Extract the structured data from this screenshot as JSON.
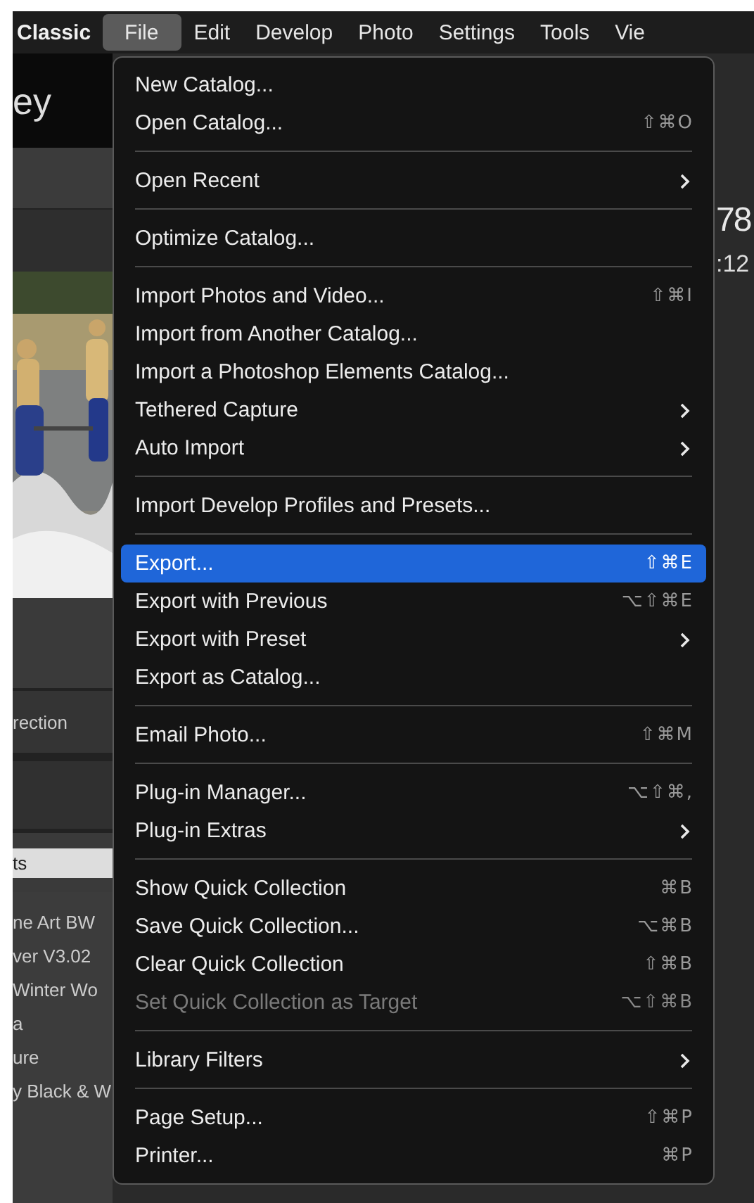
{
  "menubar": {
    "app_title": "Classic",
    "menus": [
      {
        "label": "File",
        "selected": true
      },
      {
        "label": "Edit",
        "selected": false
      },
      {
        "label": "Develop",
        "selected": false
      },
      {
        "label": "Photo",
        "selected": false
      },
      {
        "label": "Settings",
        "selected": false
      },
      {
        "label": "Tools",
        "selected": false
      },
      {
        "label": "Vie",
        "selected": false
      }
    ]
  },
  "left_panel": {
    "title": "ey",
    "section_label": "rection",
    "selected_item": "ts",
    "items": [
      "ne Art BW",
      "ver V3.02",
      "Winter Wo",
      "a",
      "ure",
      "y Black & W"
    ],
    "photo": {
      "kind": "picture"
    }
  },
  "main": {
    "count": "78",
    "time": ":12"
  },
  "file_menu": [
    {
      "kind": "item",
      "label": "New Catalog...",
      "selected": false,
      "disabled": false
    },
    {
      "kind": "item",
      "label": "Open Catalog...",
      "shortcut": "⇧⌘O",
      "selected": false,
      "disabled": false
    },
    {
      "kind": "separator"
    },
    {
      "kind": "submenu",
      "label": "Open Recent",
      "selected": false,
      "disabled": false
    },
    {
      "kind": "separator"
    },
    {
      "kind": "item",
      "label": "Optimize Catalog...",
      "selected": false,
      "disabled": false
    },
    {
      "kind": "separator"
    },
    {
      "kind": "item",
      "label": "Import Photos and Video...",
      "shortcut": "⇧⌘I",
      "selected": false,
      "disabled": false
    },
    {
      "kind": "item",
      "label": "Import from Another Catalog...",
      "selected": false,
      "disabled": false
    },
    {
      "kind": "item",
      "label": "Import a Photoshop Elements Catalog...",
      "selected": false,
      "disabled": false
    },
    {
      "kind": "submenu",
      "label": "Tethered Capture",
      "selected": false,
      "disabled": false
    },
    {
      "kind": "submenu",
      "label": "Auto Import",
      "selected": false,
      "disabled": false
    },
    {
      "kind": "separator"
    },
    {
      "kind": "item",
      "label": "Import Develop Profiles and Presets...",
      "selected": false,
      "disabled": false
    },
    {
      "kind": "separator"
    },
    {
      "kind": "item",
      "label": "Export...",
      "shortcut": "⇧⌘E",
      "selected": true,
      "disabled": false
    },
    {
      "kind": "item",
      "label": "Export with Previous",
      "shortcut": "⌥⇧⌘E",
      "selected": false,
      "disabled": false
    },
    {
      "kind": "submenu",
      "label": "Export with Preset",
      "selected": false,
      "disabled": false
    },
    {
      "kind": "item",
      "label": "Export as Catalog...",
      "selected": false,
      "disabled": false
    },
    {
      "kind": "separator"
    },
    {
      "kind": "item",
      "label": "Email Photo...",
      "shortcut": "⇧⌘M",
      "selected": false,
      "disabled": false
    },
    {
      "kind": "separator"
    },
    {
      "kind": "item",
      "label": "Plug-in Manager...",
      "shortcut": "⌥⇧⌘,",
      "selected": false,
      "disabled": false
    },
    {
      "kind": "submenu",
      "label": "Plug-in Extras",
      "selected": false,
      "disabled": false
    },
    {
      "kind": "separator"
    },
    {
      "kind": "item",
      "label": "Show Quick Collection",
      "shortcut": "⌘B",
      "selected": false,
      "disabled": false
    },
    {
      "kind": "item",
      "label": "Save Quick Collection...",
      "shortcut": "⌥⌘B",
      "selected": false,
      "disabled": false
    },
    {
      "kind": "item",
      "label": "Clear Quick Collection",
      "shortcut": "⇧⌘B",
      "selected": false,
      "disabled": false
    },
    {
      "kind": "item",
      "label": "Set Quick Collection as Target",
      "shortcut": "⌥⇧⌘B",
      "selected": false,
      "disabled": true
    },
    {
      "kind": "separator"
    },
    {
      "kind": "submenu",
      "label": "Library Filters",
      "selected": false,
      "disabled": false
    },
    {
      "kind": "separator"
    },
    {
      "kind": "item",
      "label": "Page Setup...",
      "shortcut": "⇧⌘P",
      "selected": false,
      "disabled": false
    },
    {
      "kind": "item",
      "label": "Printer...",
      "shortcut": "⌘P",
      "selected": false,
      "disabled": false
    }
  ]
}
